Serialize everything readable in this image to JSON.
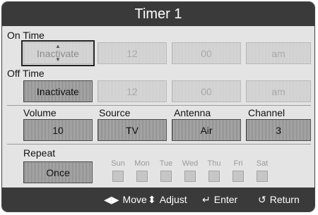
{
  "title": "Timer 1",
  "on_time": {
    "label": "On Time",
    "fields": [
      "Inactivate",
      "12",
      "00",
      "am"
    ]
  },
  "off_time": {
    "label": "Off Time",
    "fields": [
      "Inactivate",
      "12",
      "00",
      "am"
    ]
  },
  "settings": {
    "headers": [
      "Volume",
      "Source",
      "Antenna",
      "Channel"
    ],
    "values": [
      "10",
      "TV",
      "Air",
      "3"
    ]
  },
  "repeat": {
    "label": "Repeat",
    "value": "Once",
    "days": [
      "Sun",
      "Mon",
      "Tue",
      "Wed",
      "Thu",
      "Fri",
      "Sat"
    ]
  },
  "footer": {
    "move": "Move",
    "adjust": "Adjust",
    "enter": "Enter",
    "return": "Return"
  },
  "icons": {
    "move": "left-right-arrows-icon",
    "adjust": "up-down-arrows-icon",
    "enter": "enter-icon",
    "return": "return-icon"
  }
}
